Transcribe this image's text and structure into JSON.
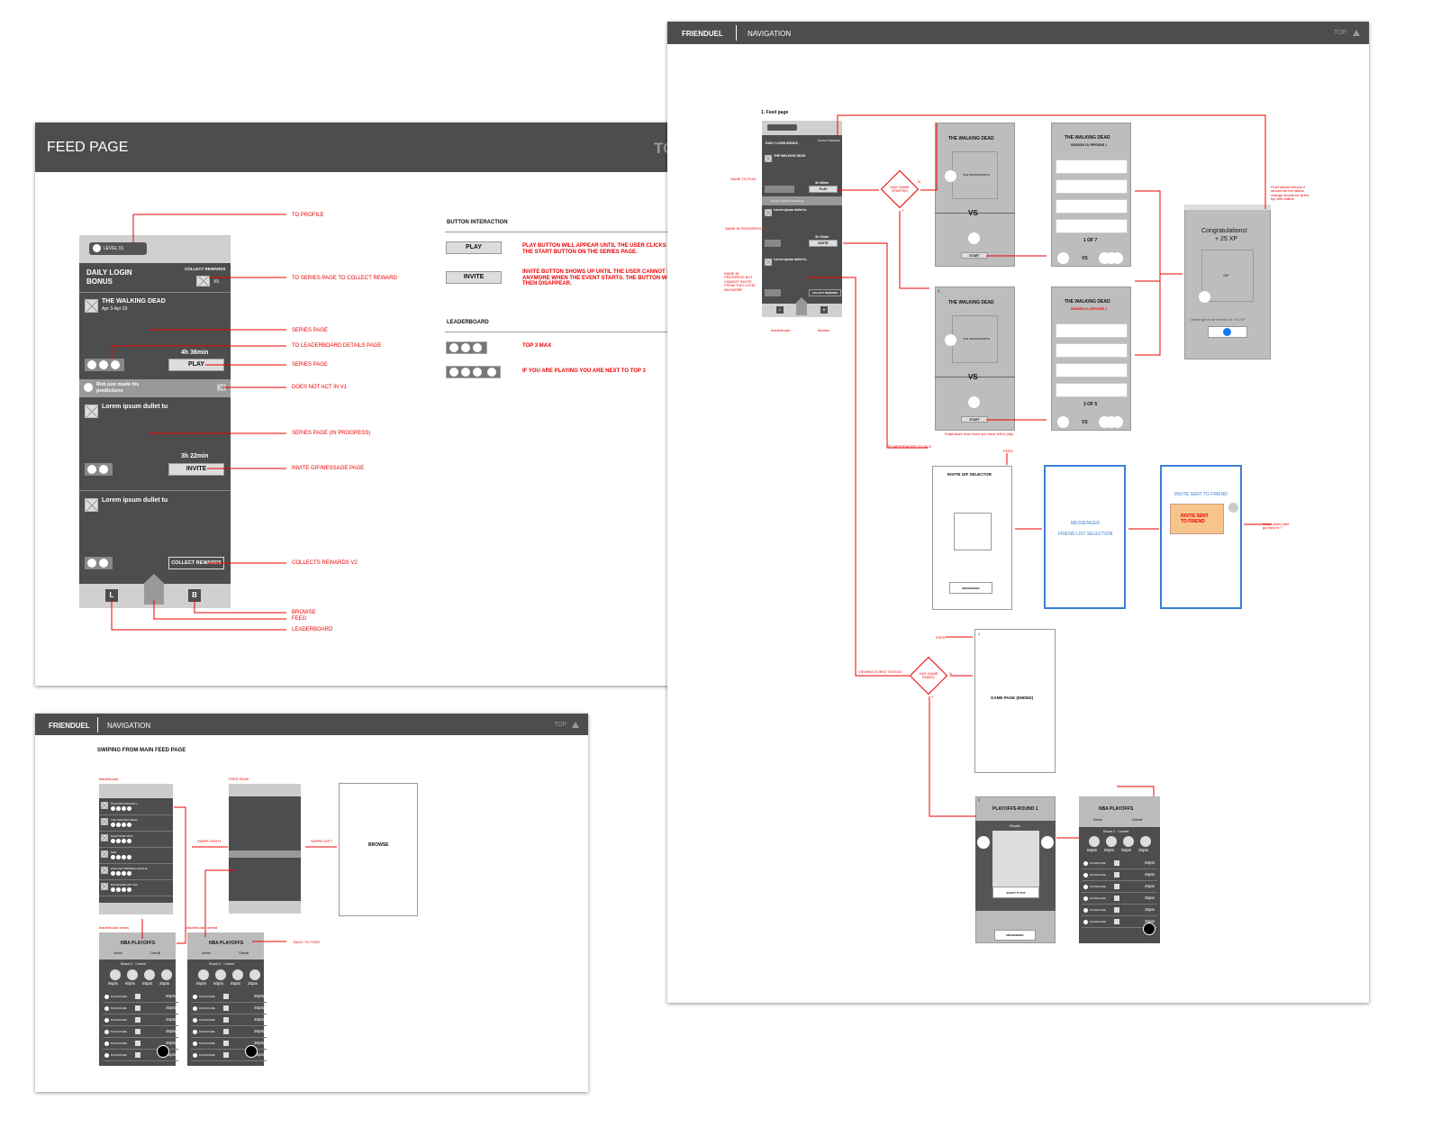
{
  "feed": {
    "title": "FEED PAGE",
    "top": "TOP",
    "level": "LEVEL 01",
    "daily": "DAILY LOGIN",
    "bonus": "BONUS",
    "collect": "COLLECT REWARDS",
    "x5": "X5",
    "wd_title": "THE WALKING DEAD",
    "wd_dates": "Apr 3-Apr 20",
    "time1": "4h 36min",
    "play": "PLAY",
    "rob": "Rob just made his",
    "rob2": "predictions",
    "lorem": "Lorem ipsum dullet tu",
    "time2": "3h 22min",
    "invite": "INVITE",
    "collect_btn": "COLLECT REWARDS",
    "L": "L",
    "B": "B",
    "ann": {
      "profile": "TO PROFILE",
      "series_collect": "TO SERIES PAGE TO COLLECT REWARD",
      "series": "SERIES PAGE",
      "leader_details": "TO LEADERBOARD DETAILS PAGE",
      "series2": "SERIES PAGE",
      "not_act": "DOES NOT ACT IN V1",
      "in_progress": "SERIES PAGE (IN PROGRESS)",
      "invite_gif": "INVITE GIF/MESSAGE PAGE",
      "collects_v2": "COLLECTS REWARDS V2",
      "browse": "BROWSE",
      "feed": "FEED",
      "leaderboard": "LEADERBOARD"
    },
    "btn_interaction": "BUTTON INTERACTION",
    "play_desc": "PLAY BUTTON WILL APPEAR UNTIL THE USER CLICKS THE START BUTTON ON THE SERIES PAGE.",
    "invite_desc": "INVITE BUTTON SHOWS UP UNTIL THE USER CANNOT INVITE ANYMORE WHEN THE EVENT STARTS. THE BUTTON WILL THEN DISAPPEAR.",
    "leaderboard": "LEADERBOARD",
    "top3": "TOP 3 MAX",
    "next_top3": "IF YOU ARE PLAYING YOU ARE NEXT TO TOP 3"
  },
  "nav1": {
    "brand": "FRIENDUEL",
    "title": "NAVIGATION",
    "top": "TOP",
    "feed_label": "1. Feed page",
    "level": "LEVEL 01",
    "daily": "DAILY LOGIN BONUS",
    "collect": "COLLECT REWARDS",
    "wd": "THE WALKING DEAD",
    "time1": "4h 36min",
    "play": "PLAY",
    "rob": "Rob just made his predictions",
    "lorem": "Lorem ipsum dullet tu",
    "time2": "3h 22min",
    "invite": "INVITE",
    "lorem2": "Lorem ipsum dullet tu",
    "collect_btn": "COLLECT REWARDS",
    "L": "L",
    "B": "B",
    "leaderboard": "leaderboard",
    "browse": "Browse",
    "same_to_play": "SAME TO PLAY",
    "same_in_progress": "SAME IN PROGRESS",
    "same_in_progress2": "SAME IN PROGRESS BUT CANNOT INVITE FROM THIS LEVEL ANYMORE",
    "has_game_started": "HAS GAME STARTED",
    "n": "N",
    "y": "Y",
    "wd1": "THE WALKING DEAD",
    "sam": "SAM PENNINGWORTH",
    "vs": "VS",
    "start": "START",
    "wd2": "THE WALKING DEAD",
    "season": "SEASON 10, EPISODE 1",
    "one_of_7": "1 OF 7",
    "vs2": "VS",
    "wd3": "THE WALKING DEAD",
    "sam2": "SAM PENNINGWORTH",
    "vs3": "VS",
    "start2": "START",
    "wd4": "THE WALKING DEAD",
    "season2": "SEASON 10, EPISODE 1",
    "three_of_5": "3 OF 5",
    "vs4": "VS",
    "emphasize": "Emphasize how much you have left to play",
    "congrats": "Congratulations!",
    "xp": "+ 25 XP",
    "gif": "GIF",
    "challenge": "Challenge more friends for +10 XP",
    "final_note": "Final should refresh it should set the status change should be at the top with status",
    "to_messenger": "TO MESSENGER TO TALK",
    "feed_up": "FEED",
    "invite_gif": "INVITE GIF SELECTOR",
    "messenger_btn": "MESSENGER",
    "messenger": "MESSENGER",
    "friend_list": "FRIEND LIST SELECTION",
    "invite_sent_title": "INVITE SENT TO FRIEND",
    "invite_sent": "INVITE SENT TO FRIEND",
    "when_exit": "When does user go back to ?",
    "feed_left": "FEED",
    "viewing_status": "VIEWING EVENT STATUS",
    "has_game_ended": "HAS GAME ENDED",
    "game_ended": "GAME PAGE (ENDED)",
    "playoffs": "PLAYOFFS-ROUND 1",
    "results": "Results",
    "shout": "SHOUT IT OUT",
    "messenger2": "MESSENGER",
    "nba": "NBA PLAYOFFS",
    "series": "Series",
    "overall": "Overall",
    "round": "Round 2 · Current",
    "pts": [
      "65pts",
      "60pts",
      "55pts",
      "25pts"
    ],
    "rows": [
      "50pts",
      "45pts",
      "40pts",
      "35pts",
      "30pts",
      "25pts"
    ],
    "player": "PLAYER NAME"
  },
  "nav2": {
    "brand": "FRIENDUEL",
    "title": "NAVIGATION",
    "top": "TOP",
    "swipe": "SWIPING FROM MAIN FEED PAGE",
    "leaderboard_lbl": "leaderboard",
    "feed_lbl": "FEED PAGE",
    "swipe_right": "SWIPE RIGHT",
    "swipe_left": "SWIPE LEFT",
    "browse": "BROWSE",
    "lb_items": [
      "PLAYOFFS ROUND 1",
      "THE WALKING DEAD",
      "ELECTIONS 2016",
      "MLB",
      "ENGLISH PREMIER LEAGUE",
      "BILLBOARD HOT 100"
    ],
    "lb_series": "leaderboard series",
    "lb_overall": "leaderboard overall",
    "back": "BACK TO FEED",
    "nba": "NBA PLAYOFFS",
    "series": "Series",
    "overall": "Overall",
    "nba_sub": "NBA PLAYOFFS",
    "round": "Round 2 · Current",
    "pts": [
      "65pts",
      "60pts",
      "55pts",
      "25pts"
    ],
    "rows": [
      "50pts",
      "45pts",
      "40pts",
      "35pts",
      "30pts",
      "25pts"
    ],
    "player": "PLAYER NAME"
  }
}
